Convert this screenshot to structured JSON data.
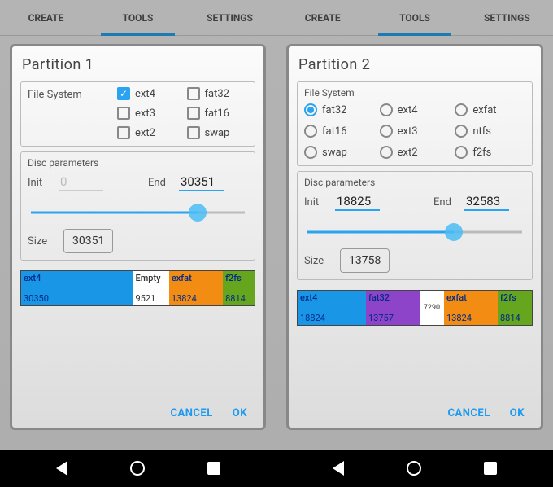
{
  "tabs": {
    "create": "CREATE",
    "tools": "TOOLS",
    "settings": "SETTINGS"
  },
  "left": {
    "title": "Partition  1",
    "fs_label": "File System",
    "fs_options": [
      {
        "label": "ext4",
        "checked": true
      },
      {
        "label": "fat32",
        "checked": false
      },
      {
        "label": "ext3",
        "checked": false
      },
      {
        "label": "fat16",
        "checked": false
      },
      {
        "label": "ext2",
        "checked": false
      },
      {
        "label": "swap",
        "checked": false
      }
    ],
    "disc_label": "Disc parameters",
    "init_label": "Init",
    "init_value": "0",
    "init_disabled": true,
    "end_label": "End",
    "end_value": "30351",
    "slider_percent": 78,
    "size_label": "Size",
    "size_value": "30351",
    "segments": [
      {
        "css": "ext4",
        "name": "ext4",
        "num": "30350",
        "flex": 48
      },
      {
        "css": "empty",
        "name": "Empty",
        "num": "9521",
        "flex": 14
      },
      {
        "css": "exfat",
        "name": "exfat",
        "num": "13824",
        "flex": 22
      },
      {
        "css": "f2fs",
        "name": "f2fs",
        "num": "8814",
        "flex": 12
      }
    ],
    "cancel": "CANCEL",
    "ok": "OK"
  },
  "right": {
    "title": "Partition  2",
    "fs_label": "File System",
    "fs_options": [
      {
        "label": "fat32",
        "checked": true
      },
      {
        "label": "ext4",
        "checked": false
      },
      {
        "label": "exfat",
        "checked": false
      },
      {
        "label": "fat16",
        "checked": false
      },
      {
        "label": "ext3",
        "checked": false
      },
      {
        "label": "ntfs",
        "checked": false
      },
      {
        "label": "swap",
        "checked": false
      },
      {
        "label": "ext2",
        "checked": false
      },
      {
        "label": "f2fs",
        "checked": false
      }
    ],
    "disc_label": "Disc parameters",
    "init_label": "Init",
    "init_value": "18825",
    "init_disabled": false,
    "end_label": "End",
    "end_value": "32583",
    "slider_percent": 68,
    "size_label": "Size",
    "size_value": "13758",
    "segments": [
      {
        "css": "ext4",
        "name": "ext4",
        "num": "18824",
        "flex": 26
      },
      {
        "css": "fat32",
        "name": "fat32",
        "num": "13757",
        "flex": 20
      },
      {
        "css": "empty small",
        "name": "",
        "num": "7290",
        "flex": 8
      },
      {
        "css": "exfat",
        "name": "exfat",
        "num": "13824",
        "flex": 20
      },
      {
        "css": "f2fs",
        "name": "f2fs",
        "num": "8814",
        "flex": 12
      }
    ],
    "cancel": "CANCEL",
    "ok": "OK"
  }
}
